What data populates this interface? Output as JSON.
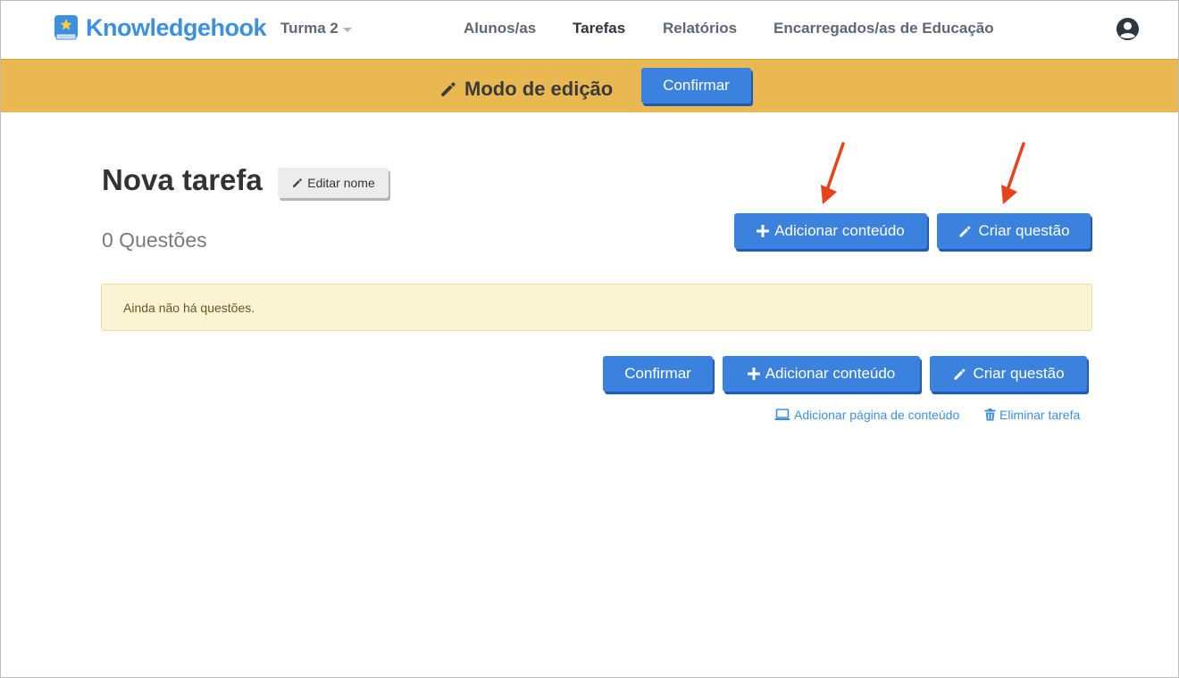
{
  "nav": {
    "brand": "Knowledgehook",
    "class_selector": "Turma 2",
    "links": [
      "Alunos/as",
      "Tarefas",
      "Relatórios",
      "Encarregados/as de Educação"
    ],
    "active_link": "Tarefas",
    "icons": {
      "logo": "book-star-logo",
      "account": "user-circle-icon"
    }
  },
  "edit_banner": {
    "label": "Modo de edição",
    "confirm_label": "Confirmar",
    "background_color": "#eab851"
  },
  "assignment": {
    "title": "Nova tarefa",
    "edit_name_label": "Editar nome",
    "question_count": "0 Questões",
    "empty_message": "Ainda não há questões."
  },
  "actions_top": {
    "add_content_label": "Adicionar conteúdo",
    "create_question_label": "Criar questão"
  },
  "actions_bottom": {
    "confirm_label": "Confirmar",
    "add_content_label": "Adicionar conteúdo",
    "create_question_label": "Criar questão",
    "add_content_page_label": "Adicionar página de conteúdo",
    "delete_assignment_label": "Eliminar tarefa"
  },
  "colors": {
    "primary_button": "#3b82de",
    "brand": "#3d8fe2",
    "annotation_arrow": "#e8421c"
  }
}
